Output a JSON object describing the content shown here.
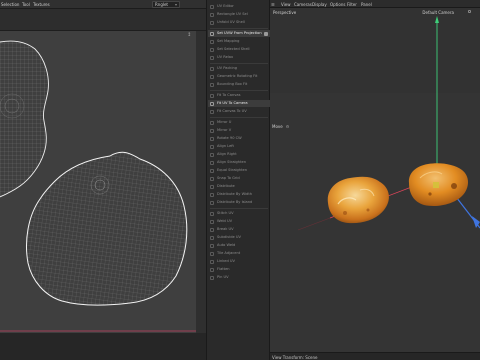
{
  "uv_editor": {
    "menu": [
      "Selection",
      "Tool",
      "Textures"
    ],
    "dropdown_value": "Rnglet",
    "corner_glyph": "↕"
  },
  "menu": {
    "items": [
      {
        "label": "UV Editor",
        "active": false
      },
      {
        "label": "Rectangle UV Sel",
        "active": false
      },
      {
        "label": "Unfold UV Shell",
        "active": false
      },
      {
        "label": "sep"
      },
      {
        "label": "Set UVW From Projection",
        "active": true,
        "checked": true
      },
      {
        "label": "Set Mapping",
        "active": false
      },
      {
        "label": "Set Selected Shell",
        "active": false
      },
      {
        "label": "UV Relax",
        "active": false
      },
      {
        "label": "sep"
      },
      {
        "label": "UV Packing",
        "active": false
      },
      {
        "label": "Geometric Rotating Fit",
        "active": false
      },
      {
        "label": "Bounding Box Fit",
        "active": false
      },
      {
        "label": "sep"
      },
      {
        "label": "Fit To Canvas",
        "active": false
      },
      {
        "label": "Fit UV To Camera",
        "active": true,
        "checked": false
      },
      {
        "label": "Fit Canvas To UV",
        "active": false
      },
      {
        "label": "sep"
      },
      {
        "label": "Mirror U",
        "active": false
      },
      {
        "label": "Mirror V",
        "active": false
      },
      {
        "label": "Rotate 90 CW",
        "active": false
      },
      {
        "label": "Align Left",
        "active": false
      },
      {
        "label": "Align Right",
        "active": false
      },
      {
        "label": "Align Straighten",
        "active": false
      },
      {
        "label": "Equal Straighten",
        "active": false
      },
      {
        "label": "Snap To Grid",
        "active": false
      },
      {
        "label": "Distribute",
        "active": false
      },
      {
        "label": "Distribute By Width",
        "active": false
      },
      {
        "label": "Distribute By Island",
        "active": false
      },
      {
        "label": "sep"
      },
      {
        "label": "Stitch UV",
        "active": false
      },
      {
        "label": "Weld UV",
        "active": false
      },
      {
        "label": "Break UV",
        "active": false
      },
      {
        "label": "Subdivide UV",
        "active": false
      },
      {
        "label": "Auto Weld",
        "active": false
      },
      {
        "label": "Tile Adjacent",
        "active": false
      },
      {
        "label": "Linked UV",
        "active": false
      },
      {
        "label": "Flatten",
        "active": false
      },
      {
        "label": "Pin UV",
        "active": false
      }
    ]
  },
  "viewport": {
    "menu": [
      "View",
      "Cameras",
      "Display",
      "Options",
      "Filter",
      "Panel"
    ],
    "label_perspective": "Perspective",
    "label_camera": "Default Camera",
    "label_move": "Move",
    "status": "View Transform: Scene",
    "colors": {
      "x_axis": "#e0455a",
      "y_axis": "#3ed07a",
      "z_axis": "#3f74e0",
      "model": "#e49a25"
    }
  }
}
